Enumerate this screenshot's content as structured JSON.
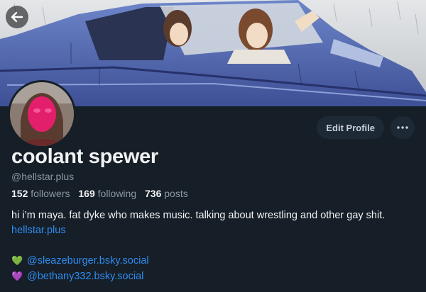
{
  "profile": {
    "display_name": "coolant spewer",
    "handle": "@hellstar.plus",
    "followers_count": "152",
    "followers_label": "followers",
    "following_count": "169",
    "following_label": "following",
    "posts_count": "736",
    "posts_label": "posts",
    "bio_text": "hi i’m maya. fat dyke who makes music. talking about wrestling and other gay shit.",
    "bio_link": "hellstar.plus",
    "linked_accounts": [
      {
        "heart": "💚",
        "heart_color": "#22c01b",
        "label": "@sleazeburger.bsky.social"
      },
      {
        "heart": "💜",
        "heart_color": "#9b6cf0",
        "label": "@bethany332.bsky.social"
      }
    ]
  },
  "actions": {
    "edit_profile_label": "Edit Profile",
    "more_icon": "more-horizontal-icon"
  },
  "colors": {
    "background": "#161e27",
    "text_primary": "#f1f3f5",
    "text_secondary": "#8b98a5",
    "link": "#2f8cf0",
    "button_bg": "#1e2936"
  }
}
